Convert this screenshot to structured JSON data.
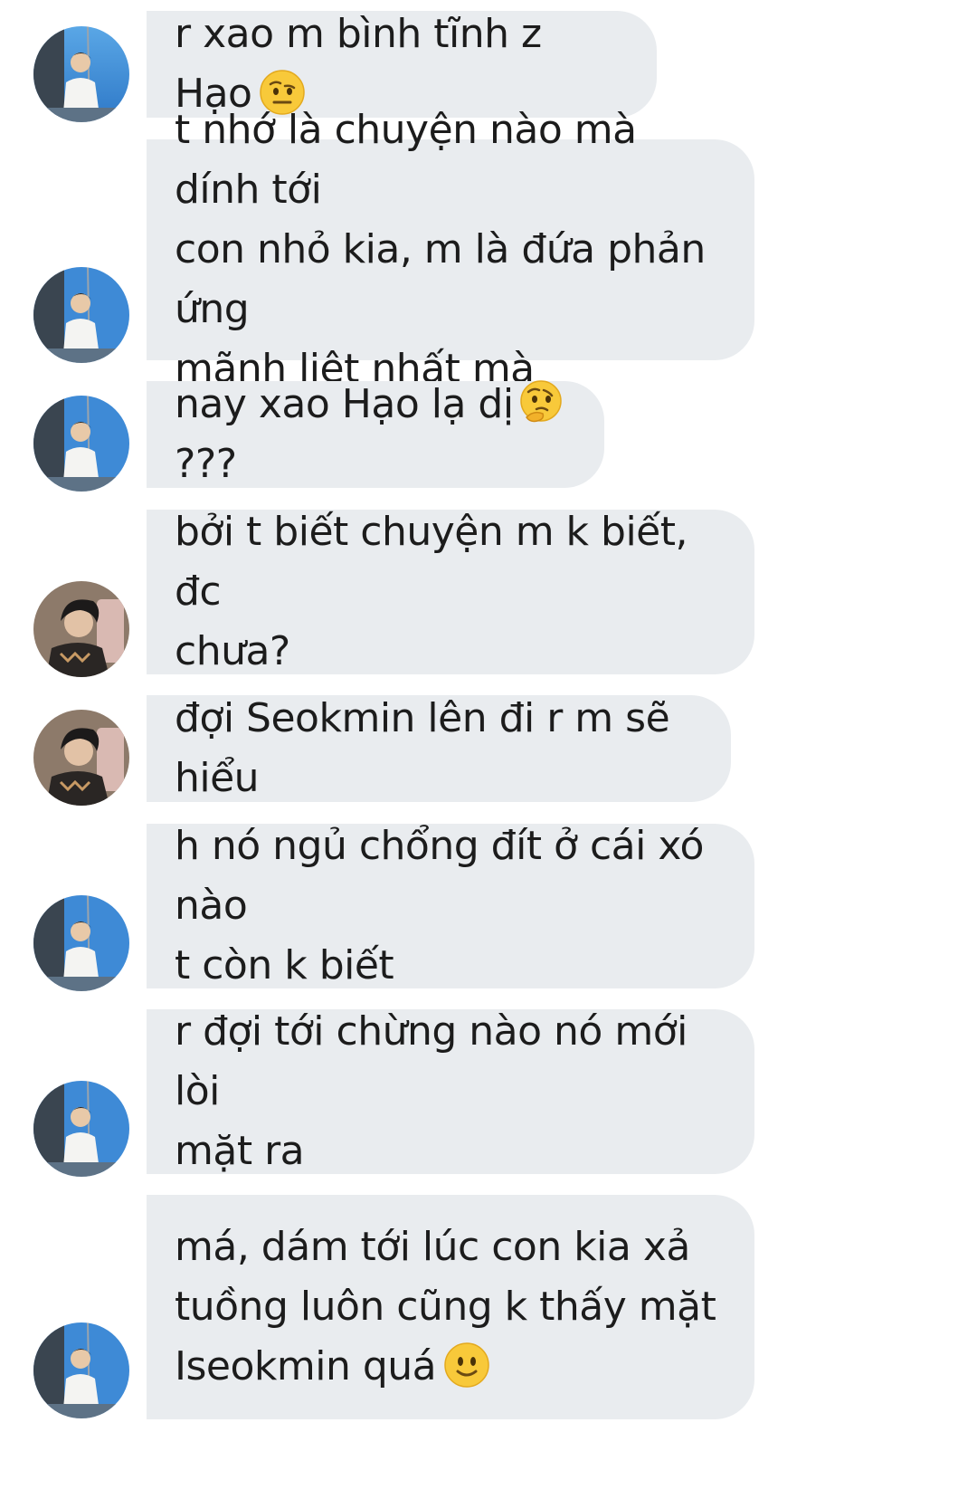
{
  "colors": {
    "bubble_bg": "#e9ecef",
    "text": "#1c1c1c",
    "emoji_yellow": "#f8c93a"
  },
  "messages": [
    {
      "sender": "avatar-a",
      "text": "r xao m bình tĩnh z Hạo",
      "emoji": "face-with-raised-eyebrow-icon"
    },
    {
      "sender": "avatar-a",
      "text": "t nhớ là chuyện nào mà dính tới\ncon nhỏ kia, m là đứa phản ứng\nmãnh liệt nhất mà"
    },
    {
      "sender": "avatar-a",
      "text": "nay xao Hạo lạ dị",
      "emoji": "thinking-face-icon",
      "suffix": "???"
    },
    {
      "sender": "avatar-b",
      "text": "bởi t biết chuyện m k biết, đc\nchưa?"
    },
    {
      "sender": "avatar-b",
      "text": "đợi Seokmin lên đi r m sẽ hiểu"
    },
    {
      "sender": "avatar-a",
      "text": "h nó ngủ chổng đít ở cái xó nào\nt còn k biết"
    },
    {
      "sender": "avatar-a",
      "text": "r đợi tới chừng nào nó mới lòi\nmặt ra"
    },
    {
      "sender": "avatar-a",
      "text": "má, dám tới lúc con kia xả\ntuồng luôn cũng k thấy mặt\nIseokmin quá",
      "emoji": "slightly-smiling-face-icon"
    }
  ]
}
